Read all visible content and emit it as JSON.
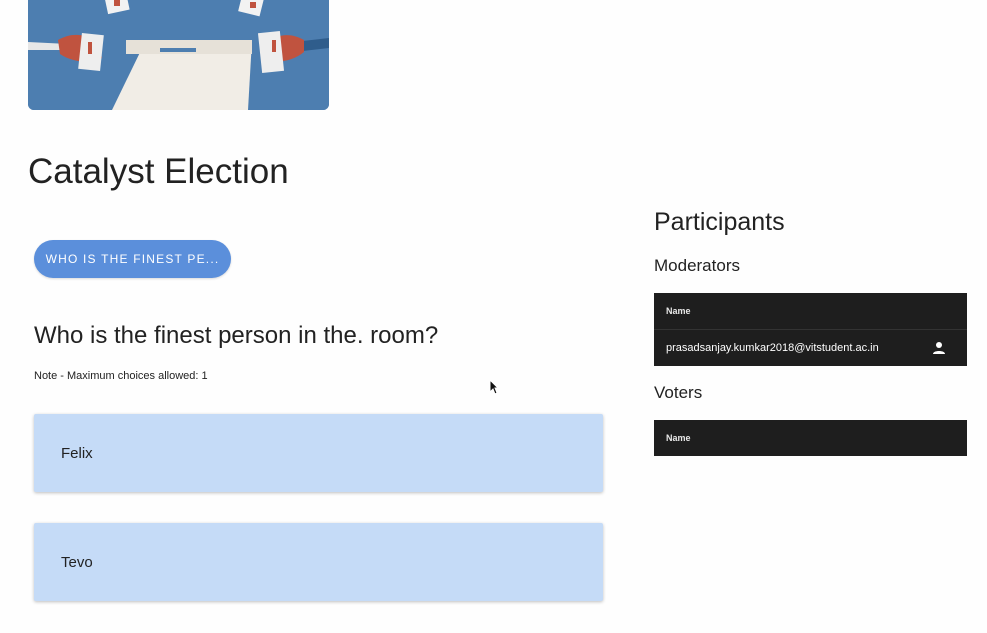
{
  "election": {
    "title": "Catalyst Election",
    "question_chip": "WHO IS THE FINEST PE...",
    "question": "Who is the finest person in the. room?",
    "note": "Note - Maximum choices allowed: 1",
    "options": [
      {
        "label": "Felix"
      },
      {
        "label": "Tevo"
      }
    ]
  },
  "participants": {
    "title": "Participants",
    "moderators": {
      "title": "Moderators",
      "column_header": "Name",
      "rows": [
        {
          "name": "prasadsanjay.kumkar2018@vitstudent.ac.in",
          "icon": "person-icon"
        }
      ]
    },
    "voters": {
      "title": "Voters",
      "column_header": "Name",
      "rows": []
    }
  },
  "colors": {
    "chip": "#5b8fdb",
    "option_bg": "#c5dbf7",
    "table_bg": "#1e1e1e",
    "banner_bg": "#4d7eb0"
  }
}
